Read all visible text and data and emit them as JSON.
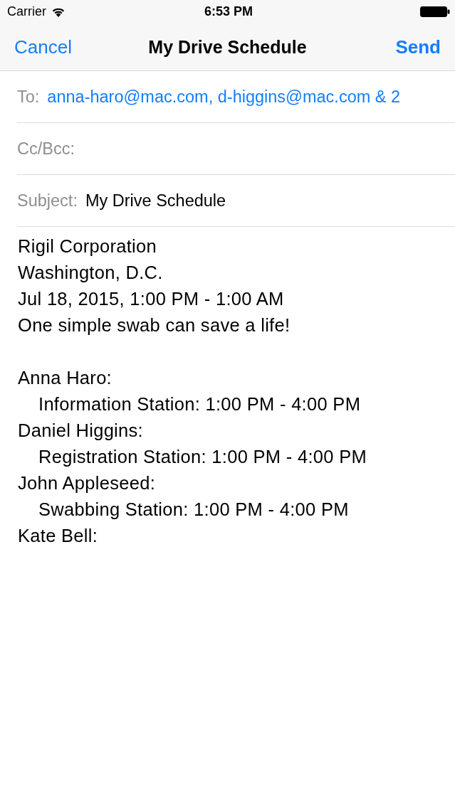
{
  "status_bar": {
    "carrier": "Carrier",
    "time": "6:53 PM"
  },
  "nav_bar": {
    "cancel": "Cancel",
    "title": "My Drive Schedule",
    "send": "Send"
  },
  "fields": [
    {
      "kind": "recipients",
      "label": "To:",
      "value": "anna-haro@mac.com, d-higgins@mac.com & 2"
    },
    {
      "label": "Cc/Bcc:"
    },
    {
      "kind": "text",
      "label": "Subject:",
      "value": "My Drive Schedule"
    }
  ],
  "body": {
    "intro": [
      "Rigil Corporation",
      "Washington, D.C.",
      "Jul 18, 2015, 1:00 PM - 1:00 AM",
      "One simple swab can save a life!"
    ],
    "volunteers": [
      {
        "text": "Anna Haro:",
        "children": [
          {
            "text": "Information Station: 1:00 PM - 4:00 PM"
          }
        ]
      },
      {
        "text": "Daniel Higgins:",
        "children": [
          {
            "text": "Registration Station: 1:00 PM - 4:00 PM"
          }
        ]
      },
      {
        "text": "John Appleseed:",
        "children": [
          {
            "text": "Swabbing Station: 1:00 PM - 4:00 PM"
          }
        ]
      },
      {
        "text": "Kate Bell:"
      }
    ]
  }
}
